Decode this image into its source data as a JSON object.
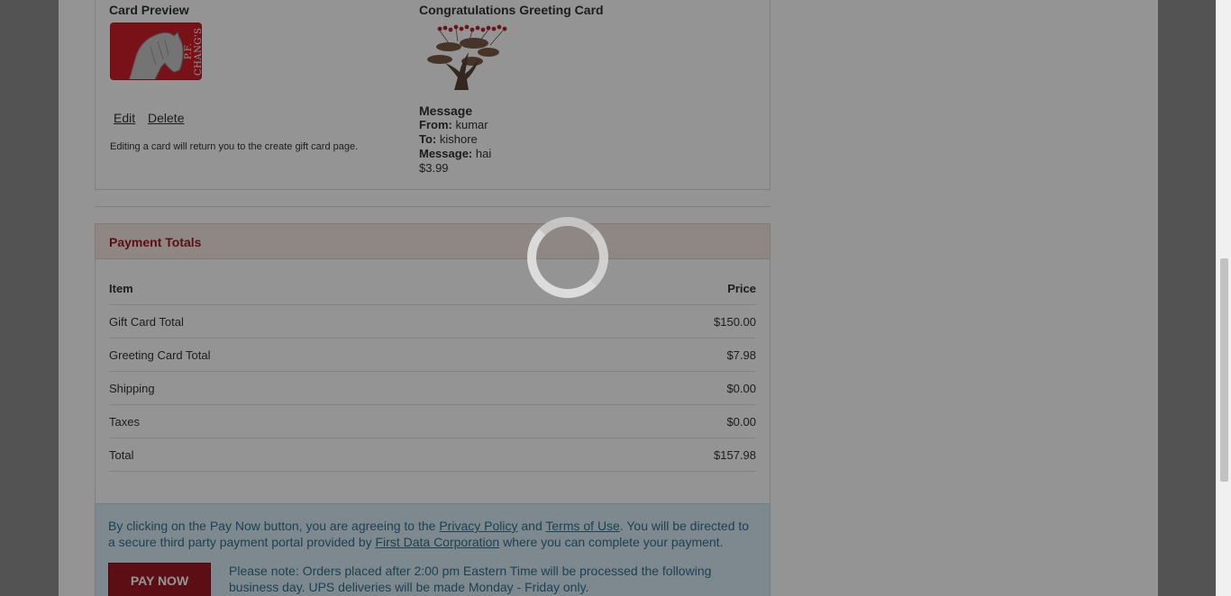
{
  "card_preview": {
    "title": "Card Preview",
    "brand": "P.F. CHANG'S",
    "edit_label": "Edit",
    "delete_label": "Delete",
    "edit_note": "Editing a card will return you to the create gift card page."
  },
  "greeting_card": {
    "title": "Congratulations Greeting Card",
    "message_heading": "Message",
    "from_label": "From:",
    "from_value": "kumar",
    "to_label": "To:",
    "to_value": "kishore",
    "message_label": "Message:",
    "message_value": "hai",
    "price": "$3.99"
  },
  "payment_totals": {
    "title": "Payment Totals",
    "columns": {
      "item": "Item",
      "price": "Price"
    },
    "rows": [
      {
        "item": "Gift Card Total",
        "price": "$150.00"
      },
      {
        "item": "Greeting Card Total",
        "price": "$7.98"
      },
      {
        "item": "Shipping",
        "price": "$0.00"
      },
      {
        "item": "Taxes",
        "price": "$0.00"
      },
      {
        "item": "Total",
        "price": "$157.98"
      }
    ]
  },
  "payment_info": {
    "text_1": "By clicking on the Pay Now button, you are agreeing to the",
    "privacy_link": "Privacy Policy",
    "text_2": "and",
    "terms_link": "Terms of Use",
    "text_3": ". You will be directed to a secure third party payment portal provided by",
    "first_data_link": "First Data Corporation",
    "text_4": "where you can complete your payment.",
    "pay_button": "PAY NOW",
    "note": "Please note: Orders placed after 2:00 pm Eastern Time will be processed the following business day. UPS deliveries will be made Monday - Friday only."
  },
  "colors": {
    "brand_red": "#9e1b25",
    "info_blue": "#31708f",
    "info_bg": "#d9edf7"
  }
}
